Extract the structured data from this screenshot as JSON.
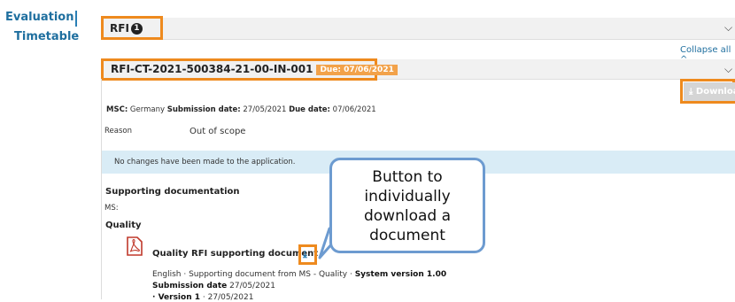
{
  "nav": {
    "items": [
      {
        "label": "Evaluation"
      },
      {
        "label": "Timetable"
      }
    ]
  },
  "rfi_panel": {
    "title": "RFI",
    "count": "1"
  },
  "collapse_all_label": "Collapse all",
  "rfi_item": {
    "id": "RFI-CT-2021-500384-21-00-IN-001",
    "due_badge": "Due: 07/06/2021",
    "download_label": "Download",
    "msc_line_prefix": "MSC:",
    "msc_value": "Germany",
    "submission_date_label": "Submission date:",
    "submission_date": "27/05/2021",
    "due_date_label": "Due date:",
    "due_date": "07/06/2021",
    "reason_label": "Reason",
    "reason_value": "Out of scope",
    "info_message": "No changes have been made to the application.",
    "supporting_heading": "Supporting documentation",
    "ms_label": "MS:",
    "quality_heading": "Quality",
    "document": {
      "title": "Quality RFI supporting document",
      "meta_line": "English · Supporting document from MS - Quality · ",
      "system_version": "System version 1.00",
      "submission_label": "Submission date",
      "submission_value": "27/05/2021",
      "version_label": "Version 1",
      "version_date": "· 27/05/2021"
    }
  },
  "callout": {
    "line1": "Button to",
    "line2": "individually",
    "line3": "download a",
    "line4": "document"
  },
  "colors": {
    "highlight": "#ee8a1e",
    "callout_border": "#6d9bd0",
    "link": "#1f6f9f",
    "info_bg": "#d9ecf6",
    "due_badge": "#f2a24a"
  },
  "icons": {
    "chevron": "chevron-down-icon",
    "pdf": "pdf-icon",
    "download": "download-icon"
  }
}
